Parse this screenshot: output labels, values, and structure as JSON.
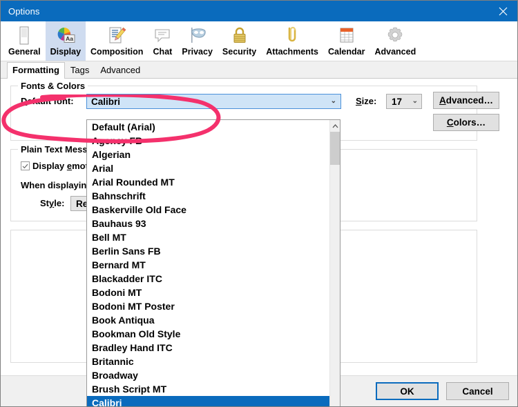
{
  "window": {
    "title": "Options",
    "close_icon": "close-icon"
  },
  "toolbar": {
    "items": [
      {
        "label": "General",
        "icon": "general-icon",
        "selected": false
      },
      {
        "label": "Display",
        "icon": "display-icon",
        "selected": true
      },
      {
        "label": "Composition",
        "icon": "composition-icon",
        "selected": false
      },
      {
        "label": "Chat",
        "icon": "chat-icon",
        "selected": false
      },
      {
        "label": "Privacy",
        "icon": "privacy-icon",
        "selected": false
      },
      {
        "label": "Security",
        "icon": "security-icon",
        "selected": false
      },
      {
        "label": "Attachments",
        "icon": "attachments-icon",
        "selected": false
      },
      {
        "label": "Calendar",
        "icon": "calendar-icon",
        "selected": false
      },
      {
        "label": "Advanced",
        "icon": "advanced-icon",
        "selected": false
      }
    ]
  },
  "tabs": [
    {
      "label": "Formatting",
      "active": true
    },
    {
      "label": "Tags",
      "active": false
    },
    {
      "label": "Advanced",
      "active": false
    }
  ],
  "fonts_group": {
    "title": "Fonts & Colors",
    "default_font_label": "Default font:",
    "default_font_value": "Calibri",
    "size_label": "Size:",
    "size_value": "17",
    "advanced_button": "Advanced…",
    "colors_button": "Colors…"
  },
  "plain_text_group": {
    "title": "Plain Text Messages",
    "display_emoticons_label": "Display emoticons as graphics",
    "display_emoticons_checked": true,
    "when_displaying_label": "When displaying quoted plain text messages",
    "style_label": "Style:",
    "style_value": "Regular"
  },
  "font_dropdown": {
    "scroll_up_icon": "chevron-up-icon",
    "selected_item": "Calibri",
    "items": [
      "Default (Arial)",
      "Agency FB",
      "Algerian",
      "Arial",
      "Arial Rounded MT",
      "Bahnschrift",
      "Baskerville Old Face",
      "Bauhaus 93",
      "Bell MT",
      "Berlin Sans FB",
      "Bernard MT",
      "Blackadder ITC",
      "Bodoni MT",
      "Bodoni MT Poster",
      "Book Antiqua",
      "Bookman Old Style",
      "Bradley Hand ITC",
      "Britannic",
      "Broadway",
      "Brush Script MT",
      "Calibri"
    ]
  },
  "footer": {
    "ok_label": "OK",
    "cancel_label": "Cancel"
  },
  "annotation": {
    "shape": "hand-drawn-ellipse",
    "color": "#f4316c"
  },
  "colors": {
    "titlebar": "#0a6bbd",
    "accent": "#0a6bbd",
    "selected_tab_bg": "#cfdcf0",
    "combo_selected_bg": "#cfe4f7",
    "annotation_pink": "#f4316c"
  }
}
